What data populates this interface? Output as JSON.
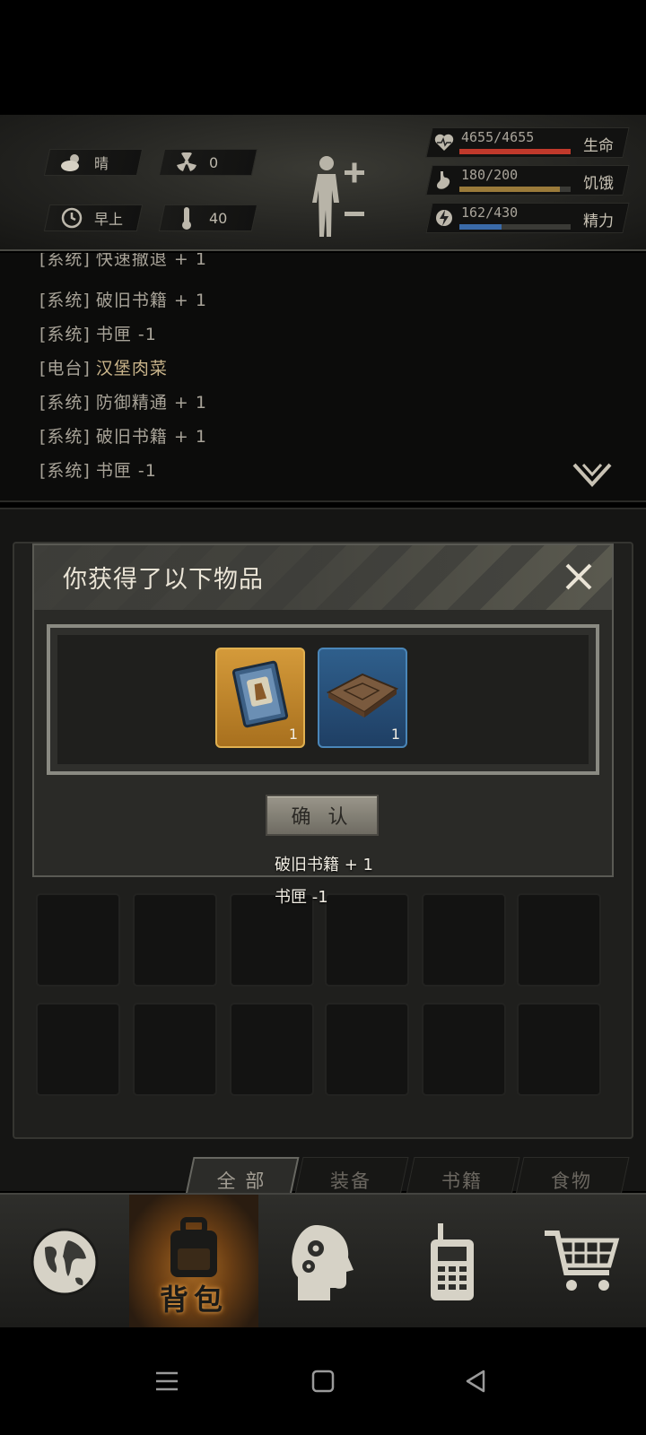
{
  "status": {
    "weather": "晴",
    "radiation": "0",
    "time_of_day": "早上",
    "temperature": "40",
    "health": {
      "value": "4655/4655",
      "label": "生命",
      "fill": 1.0,
      "color": "#c0392b"
    },
    "hunger": {
      "value": "180/200",
      "label": "饥饿",
      "fill": 0.9,
      "color": "#9a7a3a"
    },
    "energy": {
      "value": "162/430",
      "label": "精力",
      "fill": 0.377,
      "color": "#3a6aa8"
    },
    "icons": {
      "weather": "cloud-sun-icon",
      "radiation": "radiation-icon",
      "time": "clock-icon",
      "temperature": "thermometer-icon",
      "health": "heart-icon",
      "hunger": "stomach-icon",
      "energy": "lightning-icon",
      "body": "body-figure-icon"
    }
  },
  "log": {
    "lines": [
      {
        "tag": "[系统]",
        "msg": "快速撤退 + 1",
        "type": "system"
      },
      {
        "tag": "[系统]",
        "msg": "破旧书籍 + 1",
        "type": "system"
      },
      {
        "tag": "[系统]",
        "msg": "书匣 -1",
        "type": "system"
      },
      {
        "tag": "[电台]",
        "msg": "汉堡肉菜",
        "type": "radio"
      },
      {
        "tag": "[系统]",
        "msg": "防御精通 + 1",
        "type": "system"
      },
      {
        "tag": "[系统]",
        "msg": "破旧书籍 + 1",
        "type": "system"
      },
      {
        "tag": "[系统]",
        "msg": "书匣 -1",
        "type": "system"
      }
    ]
  },
  "modal": {
    "title": "你获得了以下物品",
    "confirm_label": "确 认",
    "items": [
      {
        "name": "book-item",
        "qty": "1",
        "rarity": "gold"
      },
      {
        "name": "map-item",
        "qty": "1",
        "rarity": "blue"
      }
    ]
  },
  "toasts": [
    "破旧书籍 + 1",
    "书匣 -1"
  ],
  "filters": [
    {
      "label": "全 部",
      "active": true
    },
    {
      "label": "装备",
      "active": false
    },
    {
      "label": "书籍",
      "active": false
    },
    {
      "label": "食物",
      "active": false
    }
  ],
  "bottom_nav": {
    "items": [
      {
        "icon": "globe-icon"
      },
      {
        "icon": "backpack-icon",
        "label": "背包",
        "active": true
      },
      {
        "icon": "head-gears-icon"
      },
      {
        "icon": "walkie-talkie-icon"
      },
      {
        "icon": "shopping-cart-icon"
      }
    ]
  },
  "system_nav": {
    "icons": [
      "menu-icon",
      "home-icon",
      "back-icon"
    ]
  }
}
